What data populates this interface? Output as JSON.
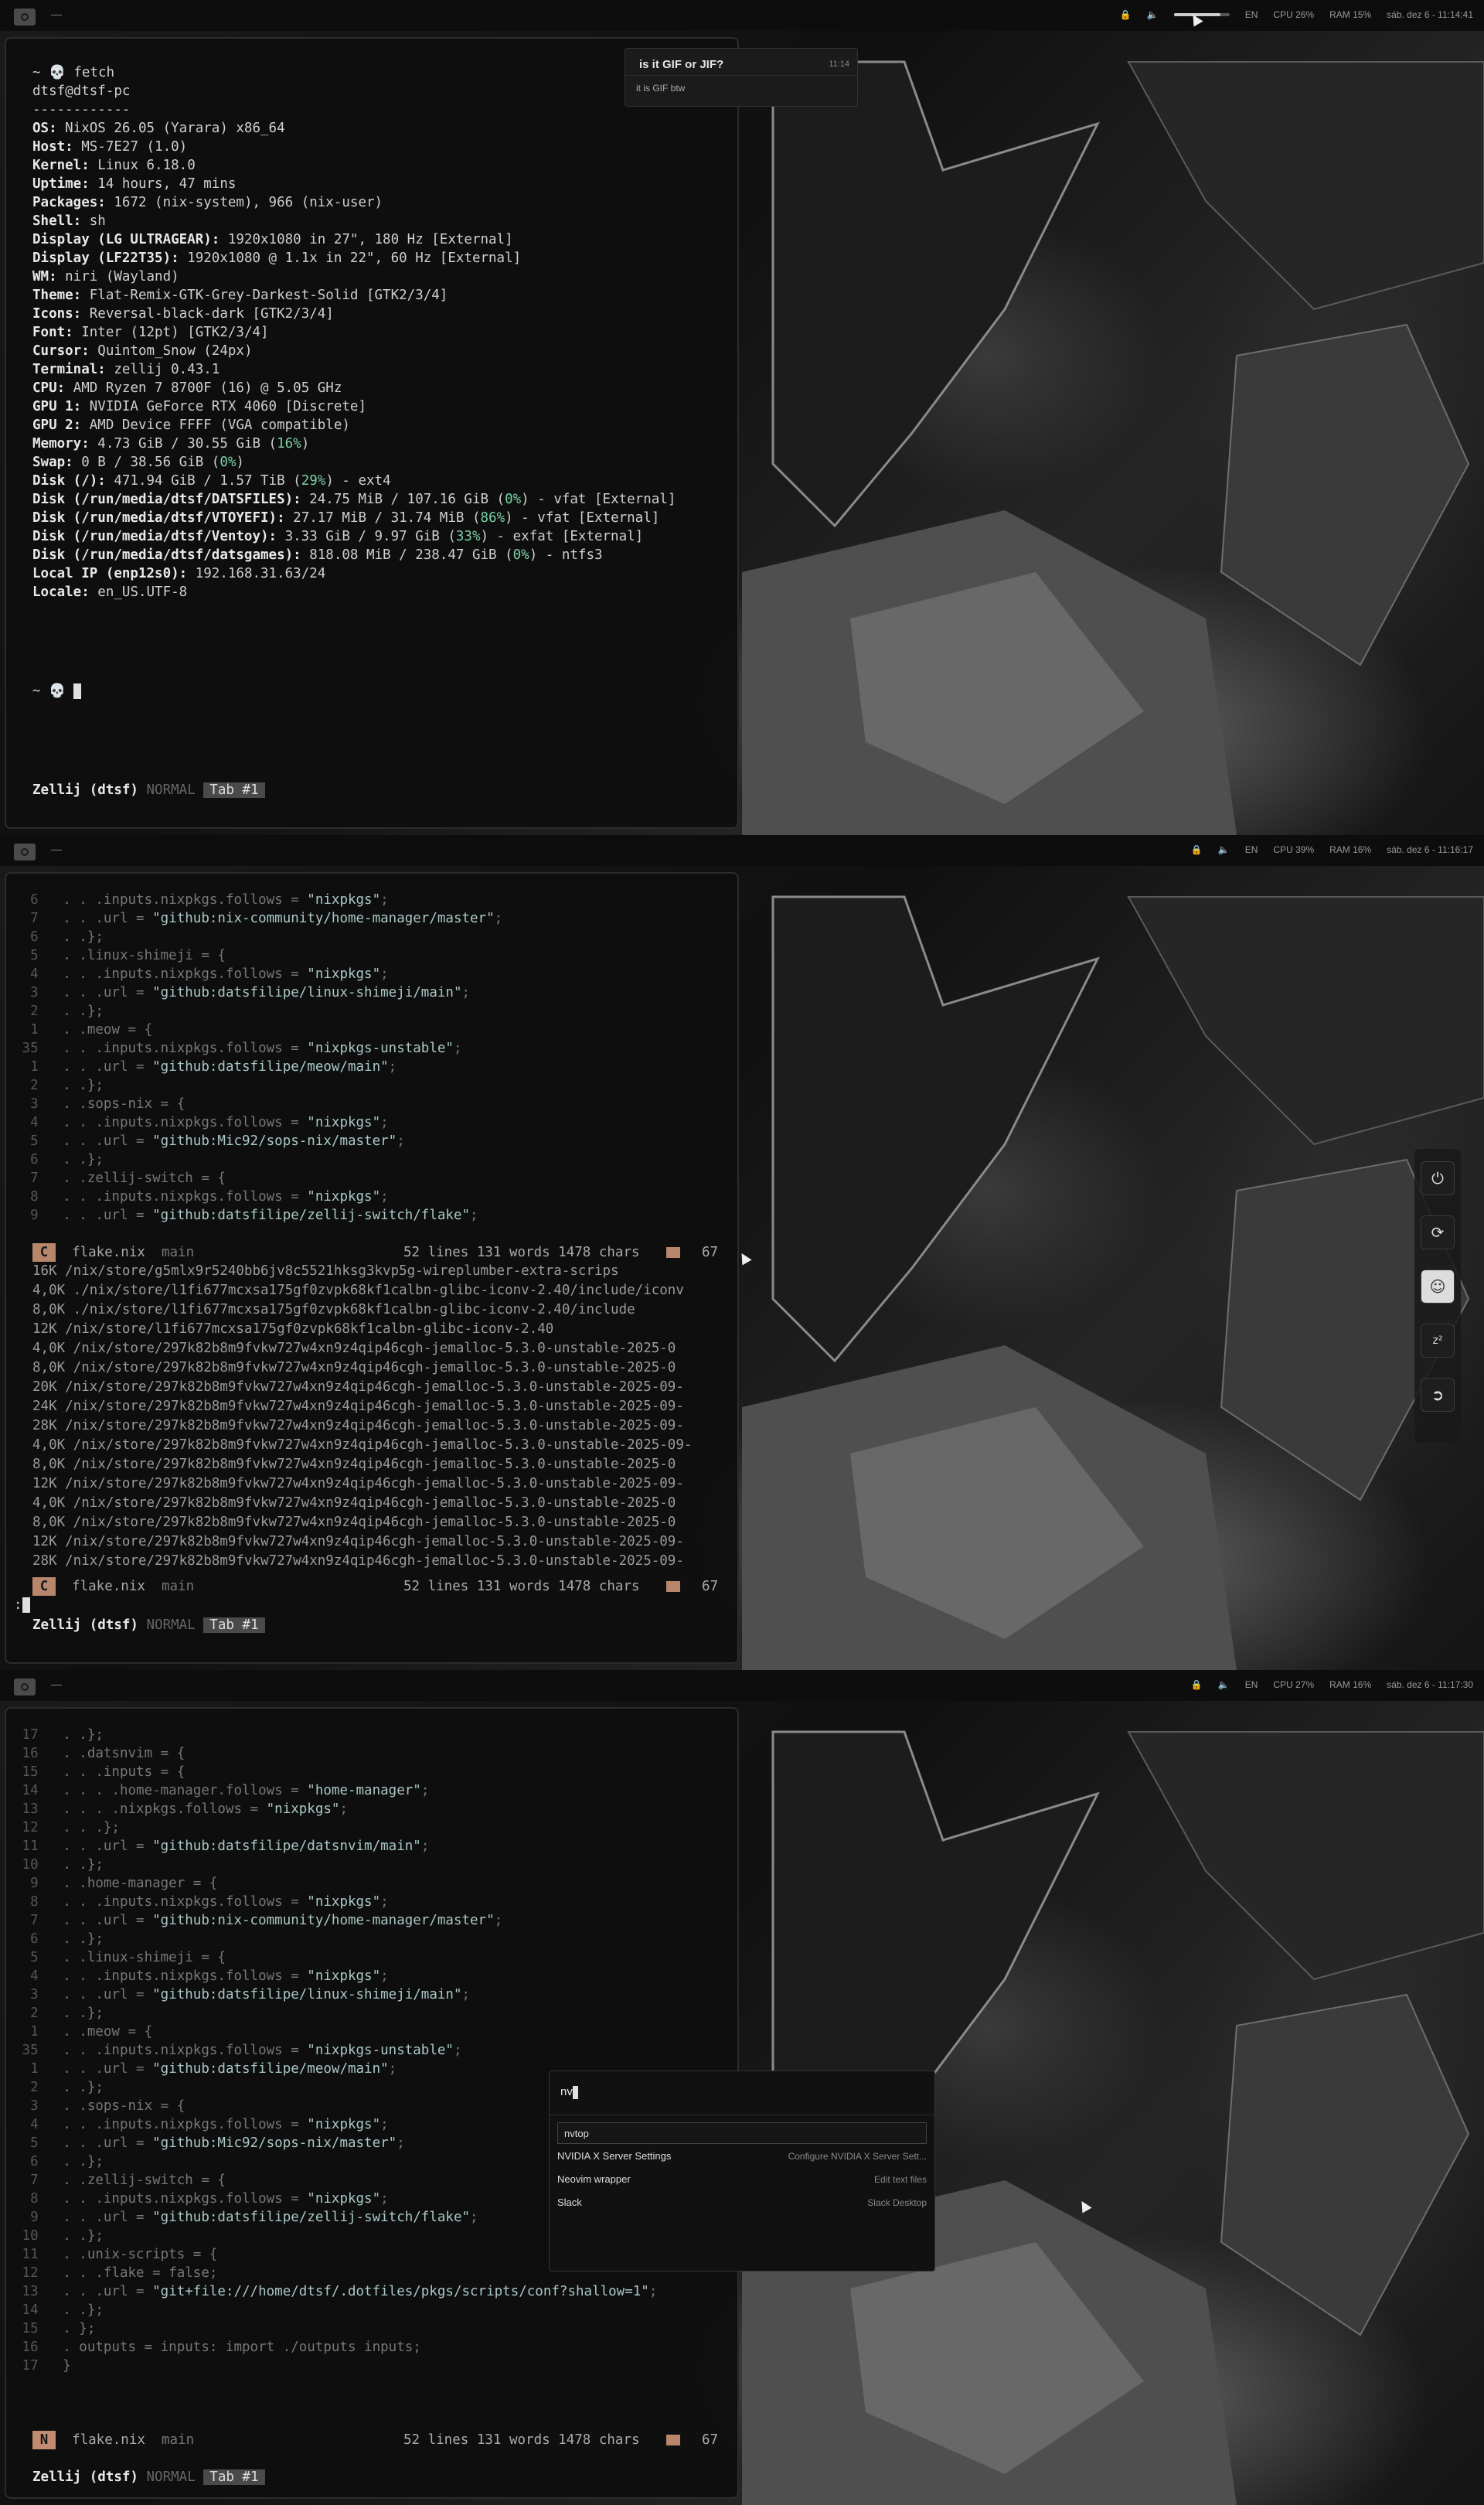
{
  "screens": [
    {
      "status": {
        "lang": "EN",
        "cpu": "CPU 26%",
        "ram": "RAM 15%",
        "clock": "sáb. dez  6 - 11:14:41"
      },
      "notification": {
        "title": "is it GIF or JIF?",
        "time": "11:14",
        "body": "it is GIF btw"
      },
      "zellij": {
        "name": "Zellij (dtsf)",
        "mode": "NORMAL",
        "tab": "Tab #1"
      }
    },
    {
      "status": {
        "lang": "EN",
        "cpu": "CPU 39%",
        "ram": "RAM 16%",
        "clock": "sáb. dez  6 - 11:16:17"
      },
      "editor_status": {
        "mode": "C",
        "file": "flake.nix",
        "branch": "main",
        "info": "52 lines 131 words 1478 chars",
        "col": "67"
      },
      "zellij": {
        "name": "Zellij (dtsf)",
        "mode": "NORMAL",
        "tab": "Tab #1"
      }
    },
    {
      "status": {
        "lang": "EN",
        "cpu": "CPU 27%",
        "ram": "RAM 16%",
        "clock": "sáb. dez  6 - 11:17:30"
      },
      "editor_status": {
        "mode": "N",
        "file": "flake.nix",
        "branch": "main",
        "info": "52 lines 131 words 1478 chars",
        "col": "67"
      },
      "launcher": {
        "query": "nv",
        "items": [
          {
            "name": "nvtop",
            "desc": ""
          },
          {
            "name": "NVIDIA X Server Settings",
            "desc": "Configure NVIDIA X Server Sett..."
          },
          {
            "name": "Neovim wrapper",
            "desc": "Edit text files"
          },
          {
            "name": "Slack",
            "desc": "Slack Desktop"
          }
        ]
      },
      "zellij": {
        "name": "Zellij (dtsf)",
        "mode": "NORMAL",
        "tab": "Tab #1"
      }
    }
  ],
  "fetch": {
    "prompt": "~ 💀 fetch",
    "userhost": "dtsf@dtsf-pc",
    "separator": "------------",
    "rows": [
      {
        "k": "OS:",
        "v": " NixOS 26.05 (Yarara) x86_64"
      },
      {
        "k": "Host:",
        "v": " MS-7E27 (1.0)"
      },
      {
        "k": "Kernel:",
        "v": " Linux 6.18.0"
      },
      {
        "k": "Uptime:",
        "v": " 14 hours, 47 mins"
      },
      {
        "k": "Packages:",
        "v": " 1672 (nix-system), 966 (nix-user)"
      },
      {
        "k": "Shell:",
        "v": " sh"
      },
      {
        "k": "Display (LG ULTRAGEAR):",
        "v": " 1920x1080 in 27\", 180 Hz [External]"
      },
      {
        "k": "Display (LF22T35):",
        "v": " 1920x1080 @ 1.1x in 22\", 60 Hz [External]"
      },
      {
        "k": "WM:",
        "v": " niri (Wayland)"
      },
      {
        "k": "Theme:",
        "v": " Flat-Remix-GTK-Grey-Darkest-Solid [GTK2/3/4]"
      },
      {
        "k": "Icons:",
        "v": " Reversal-black-dark [GTK2/3/4]"
      },
      {
        "k": "Font:",
        "v": " Inter (12pt) [GTK2/3/4]"
      },
      {
        "k": "Cursor:",
        "v": " Quintom_Snow (24px)"
      },
      {
        "k": "Terminal:",
        "v": " zellij 0.43.1"
      },
      {
        "k": "CPU:",
        "v": " AMD Ryzen 7 8700F (16) @ 5.05 GHz"
      },
      {
        "k": "GPU 1:",
        "v": " NVIDIA GeForce RTX 4060 [Discrete]"
      },
      {
        "k": "GPU 2:",
        "v": " AMD Device FFFF (VGA compatible)"
      },
      {
        "k": "Memory:",
        "v": " 4.73 GiB / 30.55 GiB (",
        "p": "16%",
        "e": ")"
      },
      {
        "k": "Swap:",
        "v": " 0 B / 38.56 GiB (",
        "p": "0%",
        "e": ")"
      },
      {
        "k": "Disk (/):",
        "v": " 471.94 GiB / 1.57 TiB (",
        "p": "29%",
        "e": ") - ext4"
      },
      {
        "k": "Disk (/run/media/dtsf/DATSFILES):",
        "v": " 24.75 MiB / 107.16 GiB (",
        "p": "0%",
        "e": ") - vfat [External]"
      },
      {
        "k": "Disk (/run/media/dtsf/VTOYEFI):",
        "v": " 27.17 MiB / 31.74 MiB (",
        "p": "86%",
        "e": ") - vfat [External]"
      },
      {
        "k": "Disk (/run/media/dtsf/Ventoy):",
        "v": " 3.33 GiB / 9.97 GiB (",
        "p": "33%",
        "e": ") - exfat [External]"
      },
      {
        "k": "Disk (/run/media/dtsf/datsgames):",
        "v": " 818.08 MiB / 238.47 GiB (",
        "p": "0%",
        "e": ") - ntfs3"
      },
      {
        "k": "Local IP (enp12s0):",
        "v": " 192.168.31.63/24"
      },
      {
        "k": "Locale:",
        "v": " en_US.UTF-8"
      }
    ],
    "prompt2": "~ 💀 "
  },
  "code2": [
    {
      "n": "6",
      "t": ". . .inputs.nixpkgs.follows = ",
      "s": "\"nixpkgs\"",
      ";": ";"
    },
    {
      "n": "7",
      "t": ". . .url = ",
      "s": "\"github:nix-community/home-manager/master\"",
      ";": ";"
    },
    {
      "n": "6",
      "t": ". .};",
      "s": "",
      ";": ""
    },
    {
      "n": "5",
      "t": ". .linux-shimeji = {",
      "s": "",
      ";": ""
    },
    {
      "n": "4",
      "t": ". . .inputs.nixpkgs.follows = ",
      "s": "\"nixpkgs\"",
      ";": ";"
    },
    {
      "n": "3",
      "t": ". . .url = ",
      "s": "\"github:datsfilipe/linux-shimeji/main\"",
      ";": ";"
    },
    {
      "n": "2",
      "t": ". .};",
      "s": "",
      ";": ""
    },
    {
      "n": "1",
      "t": ". .meow = {",
      "s": "",
      ";": ""
    },
    {
      "n": "35",
      "t": ". . .inputs.nixpkgs.follows = ",
      "s": "\"nixpkgs-unstable\"",
      ";": ";"
    },
    {
      "n": "1",
      "t": ". . .url = ",
      "s": "\"github:datsfilipe/meow/main\"",
      ";": ";"
    },
    {
      "n": "2",
      "t": ". .};",
      "s": "",
      ";": ""
    },
    {
      "n": "3",
      "t": ". .sops-nix = {",
      "s": "",
      ";": ""
    },
    {
      "n": "4",
      "t": ". . .inputs.nixpkgs.follows = ",
      "s": "\"nixpkgs\"",
      ";": ";"
    },
    {
      "n": "5",
      "t": ". . .url = ",
      "s": "\"github:Mic92/sops-nix/master\"",
      ";": ";"
    },
    {
      "n": "6",
      "t": ". .};",
      "s": "",
      ";": ""
    },
    {
      "n": "7",
      "t": ". .zellij-switch = {",
      "s": "",
      ";": ""
    },
    {
      "n": "8",
      "t": ". . .inputs.nixpkgs.follows = ",
      "s": "\"nixpkgs\"",
      ";": ";"
    },
    {
      "n": "9",
      "t": ". . .url = ",
      "s": "\"github:datsfilipe/zellij-switch/flake\"",
      ";": ";"
    }
  ],
  "store": [
    "16K /nix/store/g5mlx9r5240bb6jv8c5521hksg3kvp5g-wireplumber-extra-scrips",
    "4,0K ./nix/store/l1fi677mcxsa175gf0zvpk68kf1calbn-glibc-iconv-2.40/include/iconv",
    "8,0K ./nix/store/l1fi677mcxsa175gf0zvpk68kf1calbn-glibc-iconv-2.40/include",
    "12K /nix/store/l1fi677mcxsa175gf0zvpk68kf1calbn-glibc-iconv-2.40",
    "4,0K /nix/store/297k82b8m9fvkw727w4xn9z4qip46cgh-jemalloc-5.3.0-unstable-2025-0",
    "8,0K /nix/store/297k82b8m9fvkw727w4xn9z4qip46cgh-jemalloc-5.3.0-unstable-2025-0",
    "20K /nix/store/297k82b8m9fvkw727w4xn9z4qip46cgh-jemalloc-5.3.0-unstable-2025-09-",
    "24K /nix/store/297k82b8m9fvkw727w4xn9z4qip46cgh-jemalloc-5.3.0-unstable-2025-09-",
    "28K /nix/store/297k82b8m9fvkw727w4xn9z4qip46cgh-jemalloc-5.3.0-unstable-2025-09-",
    "4,0K /nix/store/297k82b8m9fvkw727w4xn9z4qip46cgh-jemalloc-5.3.0-unstable-2025-09-",
    "8,0K /nix/store/297k82b8m9fvkw727w4xn9z4qip46cgh-jemalloc-5.3.0-unstable-2025-0",
    "12K /nix/store/297k82b8m9fvkw727w4xn9z4qip46cgh-jemalloc-5.3.0-unstable-2025-09-",
    "4,0K /nix/store/297k82b8m9fvkw727w4xn9z4qip46cgh-jemalloc-5.3.0-unstable-2025-0",
    "8,0K /nix/store/297k82b8m9fvkw727w4xn9z4qip46cgh-jemalloc-5.3.0-unstable-2025-0",
    "12K /nix/store/297k82b8m9fvkw727w4xn9z4qip46cgh-jemalloc-5.3.0-unstable-2025-09-",
    "28K /nix/store/297k82b8m9fvkw727w4xn9z4qip46cgh-jemalloc-5.3.0-unstable-2025-09-"
  ],
  "cmdline": ":",
  "code3": [
    {
      "n": "17",
      "t": ". .};",
      "s": "",
      ";": ""
    },
    {
      "n": "16",
      "t": ". .datsnvim = {",
      "s": "",
      ";": ""
    },
    {
      "n": "15",
      "t": ". . .inputs = {",
      "s": "",
      ";": ""
    },
    {
      "n": "14",
      "t": ". . . .home-manager.follows = ",
      "s": "\"home-manager\"",
      ";": ";"
    },
    {
      "n": "13",
      "t": ". . . .nixpkgs.follows = ",
      "s": "\"nixpkgs\"",
      ";": ";"
    },
    {
      "n": "12",
      "t": ". . .};",
      "s": "",
      ";": ""
    },
    {
      "n": "11",
      "t": ". . .url = ",
      "s": "\"github:datsfilipe/datsnvim/main\"",
      ";": ";"
    },
    {
      "n": "10",
      "t": ". .};",
      "s": "",
      ";": ""
    },
    {
      "n": "9",
      "t": ". .home-manager = {",
      "s": "",
      ";": ""
    },
    {
      "n": "8",
      "t": ". . .inputs.nixpkgs.follows = ",
      "s": "\"nixpkgs\"",
      ";": ";"
    },
    {
      "n": "7",
      "t": ". . .url = ",
      "s": "\"github:nix-community/home-manager/master\"",
      ";": ";"
    },
    {
      "n": "6",
      "t": ". .};",
      "s": "",
      ";": ""
    },
    {
      "n": "5",
      "t": ". .linux-shimeji = {",
      "s": "",
      ";": ""
    },
    {
      "n": "4",
      "t": ". . .inputs.nixpkgs.follows = ",
      "s": "\"nixpkgs\"",
      ";": ";"
    },
    {
      "n": "3",
      "t": ". . .url = ",
      "s": "\"github:datsfilipe/linux-shimeji/main\"",
      ";": ";"
    },
    {
      "n": "2",
      "t": ". .};",
      "s": "",
      ";": ""
    },
    {
      "n": "1",
      "t": ". .meow = {",
      "s": "",
      ";": ""
    },
    {
      "n": "35",
      "t": ". . .inputs.nixpkgs.follows = ",
      "s": "\"nixpkgs-unstable\"",
      ";": ";"
    },
    {
      "n": "1",
      "t": ". . .url = ",
      "s": "\"github:datsfilipe/meow/main\"",
      ";": ";"
    },
    {
      "n": "2",
      "t": ". .};",
      "s": "",
      ";": ""
    },
    {
      "n": "3",
      "t": ". .sops-nix = {",
      "s": "",
      ";": ""
    },
    {
      "n": "4",
      "t": ". . .inputs.nixpkgs.follows = ",
      "s": "\"nixpkgs\"",
      ";": ";"
    },
    {
      "n": "5",
      "t": ". . .url = ",
      "s": "\"github:Mic92/sops-nix/master\"",
      ";": ";"
    },
    {
      "n": "6",
      "t": ". .};",
      "s": "",
      ";": ""
    },
    {
      "n": "7",
      "t": ". .zellij-switch = {",
      "s": "",
      ";": ""
    },
    {
      "n": "8",
      "t": ". . .inputs.nixpkgs.follows = ",
      "s": "\"nixpkgs\"",
      ";": ";"
    },
    {
      "n": "9",
      "t": ". . .url = ",
      "s": "\"github:datsfilipe/zellij-switch/flake\"",
      ";": ";"
    },
    {
      "n": "10",
      "t": ". .};",
      "s": "",
      ";": ""
    },
    {
      "n": "11",
      "t": ". .unix-scripts = {",
      "s": "",
      ";": ""
    },
    {
      "n": "12",
      "t": ". . .flake = false;",
      "s": "",
      ";": ""
    },
    {
      "n": "13",
      "t": ". . .url = ",
      "s": "\"git+file:///home/dtsf/.dotfiles/pkgs/scripts/conf?shallow=1\"",
      ";": ";"
    },
    {
      "n": "14",
      "t": ". .};",
      "s": "",
      ";": ""
    },
    {
      "n": "15",
      "t": ". };",
      "s": "",
      ";": ""
    },
    {
      "n": "16",
      "t": ". outputs = inputs: import ./outputs inputs;",
      "s": "",
      ";": ""
    },
    {
      "n": "17",
      "t": "}",
      "s": "",
      ";": ""
    }
  ]
}
